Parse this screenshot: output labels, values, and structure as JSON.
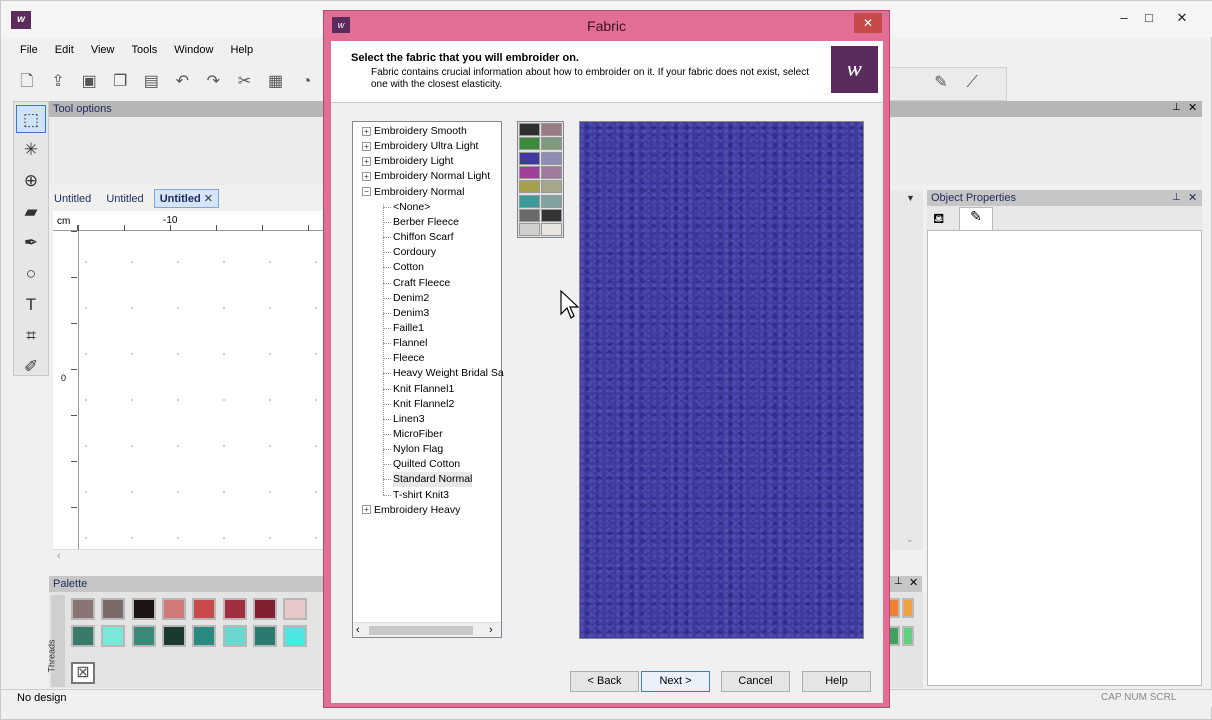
{
  "app": {
    "menu": [
      "File",
      "Edit",
      "View",
      "Tools",
      "Window",
      "Help"
    ],
    "window_buttons": {
      "minimize": "–",
      "maximize": "□",
      "close": "✕"
    }
  },
  "panels": {
    "tool_options": "Tool options",
    "object_properties": "Object Properties",
    "palette": "Palette",
    "threads_tab": "Threads"
  },
  "tabs": [
    {
      "label": "Untitled"
    },
    {
      "label": "Untitled"
    },
    {
      "label": "Untitled",
      "active": true,
      "close": "✕"
    }
  ],
  "ruler": {
    "unit": "cm",
    "h_tick": "-10",
    "v_tick": "0"
  },
  "status": {
    "text": "No design",
    "keys": "CAP  NUM  SCRL"
  },
  "dialog": {
    "title": "Fabric",
    "close": "✕",
    "heading": "Select the fabric that you will embroider on.",
    "subheading": "Fabric contains crucial information about how to embroider on it. If your fabric does not exist, select one with the closest elasticity.",
    "tree": [
      {
        "label": "Embroidery Smooth",
        "type": "group",
        "expand": "+"
      },
      {
        "label": "Embroidery Ultra Light",
        "type": "group",
        "expand": "+"
      },
      {
        "label": "Embroidery Light",
        "type": "group",
        "expand": "+"
      },
      {
        "label": "Embroidery Normal Light",
        "type": "group",
        "expand": "+"
      },
      {
        "label": "Embroidery Normal",
        "type": "group",
        "expand": "−"
      },
      {
        "label": "<None>",
        "type": "child"
      },
      {
        "label": "Berber Fleece",
        "type": "child"
      },
      {
        "label": "Chiffon Scarf",
        "type": "child"
      },
      {
        "label": "Cordoury",
        "type": "child"
      },
      {
        "label": "Cotton",
        "type": "child"
      },
      {
        "label": "Craft Fleece",
        "type": "child"
      },
      {
        "label": "Denim2",
        "type": "child"
      },
      {
        "label": "Denim3",
        "type": "child"
      },
      {
        "label": "Faille1",
        "type": "child"
      },
      {
        "label": "Flannel",
        "type": "child"
      },
      {
        "label": "Fleece",
        "type": "child"
      },
      {
        "label": "Heavy Weight Bridal Sa",
        "type": "child"
      },
      {
        "label": "Knit Flannel1",
        "type": "child"
      },
      {
        "label": "Knit Flannel2",
        "type": "child"
      },
      {
        "label": "Linen3",
        "type": "child"
      },
      {
        "label": "MicroFiber",
        "type": "child"
      },
      {
        "label": "Nylon Flag",
        "type": "child"
      },
      {
        "label": "Quilted Cotton",
        "type": "child"
      },
      {
        "label": "Standard Normal",
        "type": "child",
        "selected": true
      },
      {
        "label": "T-shirt Knit3",
        "type": "child"
      },
      {
        "label": "Embroidery Heavy",
        "type": "group",
        "expand": "+"
      }
    ],
    "fabric_colors": [
      "#2f2f2f",
      "#9b7a83",
      "#3b8b3b",
      "#7f9a7f",
      "#3e3aa0",
      "#8d8db8",
      "#a0409a",
      "#a07a9a",
      "#a6a04a",
      "#a6a68a",
      "#3c9a9a",
      "#80a2a2",
      "#6a6a6a",
      "#333333",
      "#cfcfcf",
      "#e8e6de"
    ],
    "preview_color": "#3e3a9e",
    "buttons": {
      "back": "< Back",
      "next": "Next >",
      "cancel": "Cancel",
      "help": "Help"
    }
  },
  "palette_colors": [
    "#8a7474",
    "#7a6a6a",
    "#1e1414",
    "#d07a7a",
    "#c84a4a",
    "#a03040",
    "#802030",
    "#e8c8c8",
    "#3a7a6a",
    "#7ae8d8",
    "#3a8a7a",
    "#1a3a30",
    "#2a8a80",
    "#6ad8d0",
    "#2a7a70",
    "#4ae8e0"
  ]
}
